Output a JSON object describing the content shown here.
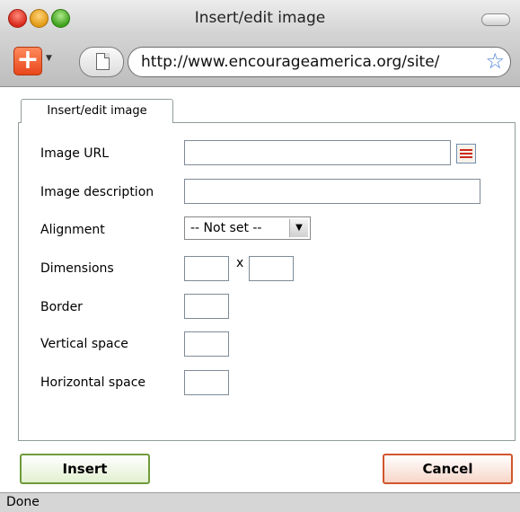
{
  "window": {
    "title": "Insert/edit image"
  },
  "toolbar": {
    "url": "http://www.encourageamerica.org/site/"
  },
  "dialog": {
    "tab_label": "Insert/edit image",
    "labels": {
      "image_url": "Image URL",
      "image_description": "Image description",
      "alignment": "Alignment",
      "dimensions": "Dimensions",
      "border": "Border",
      "vertical_space": "Vertical space",
      "horizontal_space": "Horizontal space"
    },
    "fields": {
      "image_url": "",
      "image_description": "",
      "width": "",
      "height": "",
      "border": "",
      "vertical_space": "",
      "horizontal_space": ""
    },
    "alignment_selected": "-- Not set --",
    "dimension_separator": "x",
    "insert_label": "Insert",
    "cancel_label": "Cancel"
  },
  "status": {
    "text": "Done"
  },
  "colors": {
    "insert_border": "#6e9c3a",
    "cancel_border": "#d2562c",
    "star": "#4a7fd6"
  },
  "icons": [
    "close-traffic-light-icon",
    "minimize-traffic-light-icon",
    "zoom-traffic-light-icon",
    "toolbar-pill-icon",
    "addon-plus-icon",
    "page-icon",
    "bookmark-star-icon",
    "browse-image-icon",
    "dropdown-arrow-icon"
  ]
}
